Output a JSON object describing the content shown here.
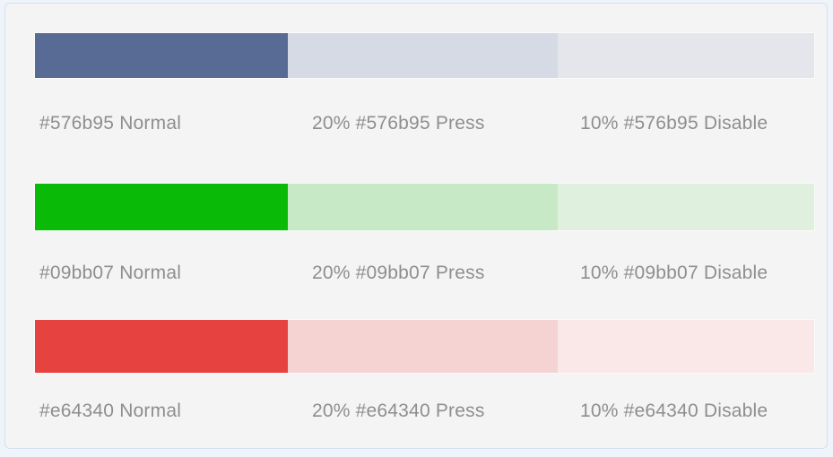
{
  "card": {
    "background": "#f4f4f4",
    "border_color": "#d3e2f2",
    "page_background": "#eef4fa"
  },
  "caption_color": "#8e8e8e",
  "rows": [
    {
      "name": "blue",
      "base_hex": "#576b95",
      "segments": [
        {
          "state": "Normal",
          "opacity": "100%",
          "fill": "#576b95",
          "caption": "#576b95   Normal"
        },
        {
          "state": "Press",
          "opacity": "20%",
          "fill": "#d5dae4",
          "caption": "20%  #576b95 Press"
        },
        {
          "state": "Disable",
          "opacity": "10%",
          "fill": "#e4e6ec",
          "caption": "10%  #576b95 Disable"
        }
      ]
    },
    {
      "name": "green",
      "base_hex": "#09bb07",
      "segments": [
        {
          "state": "Normal",
          "opacity": "100%",
          "fill": "#09bb07",
          "caption": "#09bb07   Normal"
        },
        {
          "state": "Press",
          "opacity": "20%",
          "fill": "#c7e9c5",
          "caption": "20%  #09bb07  Press"
        },
        {
          "state": "Disable",
          "opacity": "10%",
          "fill": "#dff1de",
          "caption": "10%  #09bb07 Disable"
        }
      ]
    },
    {
      "name": "red",
      "base_hex": "#e64340",
      "segments": [
        {
          "state": "Normal",
          "opacity": "100%",
          "fill": "#e64340",
          "caption": "#e64340   Normal"
        },
        {
          "state": "Press",
          "opacity": "20%",
          "fill": "#f5d3d2",
          "caption": "20%  #e64340  Press"
        },
        {
          "state": "Disable",
          "opacity": "10%",
          "fill": "#fae8e8",
          "caption": "10%  #e64340 Disable"
        }
      ]
    }
  ]
}
